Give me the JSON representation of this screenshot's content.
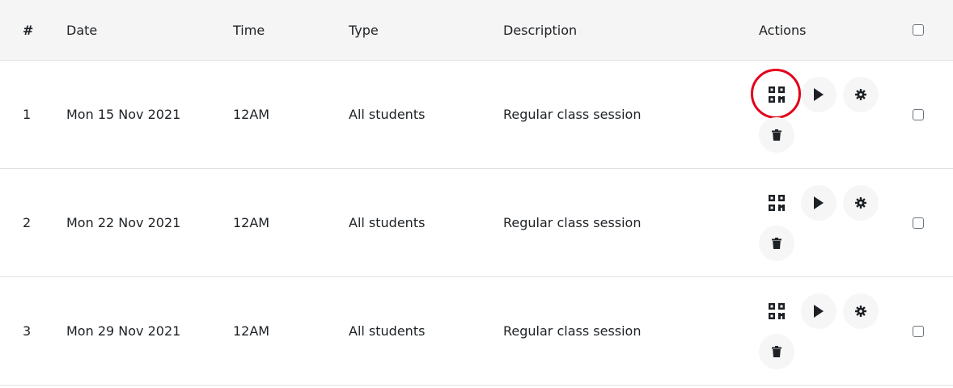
{
  "table": {
    "headers": {
      "num": "#",
      "date": "Date",
      "time": "Time",
      "type": "Type",
      "description": "Description",
      "actions": "Actions"
    },
    "rows": [
      {
        "num": "1",
        "date": "Mon 15 Nov 2021",
        "time": "12AM",
        "type": "All students",
        "description": "Regular class session"
      },
      {
        "num": "2",
        "date": "Mon 22 Nov 2021",
        "time": "12AM",
        "type": "All students",
        "description": "Regular class session"
      },
      {
        "num": "3",
        "date": "Mon 29 Nov 2021",
        "time": "12AM",
        "type": "All students",
        "description": "Regular class session"
      }
    ]
  },
  "icons": {
    "qr": "qr-code-icon",
    "play": "play-icon",
    "settings": "gear-icon",
    "delete": "trash-icon"
  },
  "colors": {
    "highlight": "#e3001b",
    "header_bg": "#f5f5f5",
    "text": "#1d2125",
    "icon": "#1d2125"
  }
}
